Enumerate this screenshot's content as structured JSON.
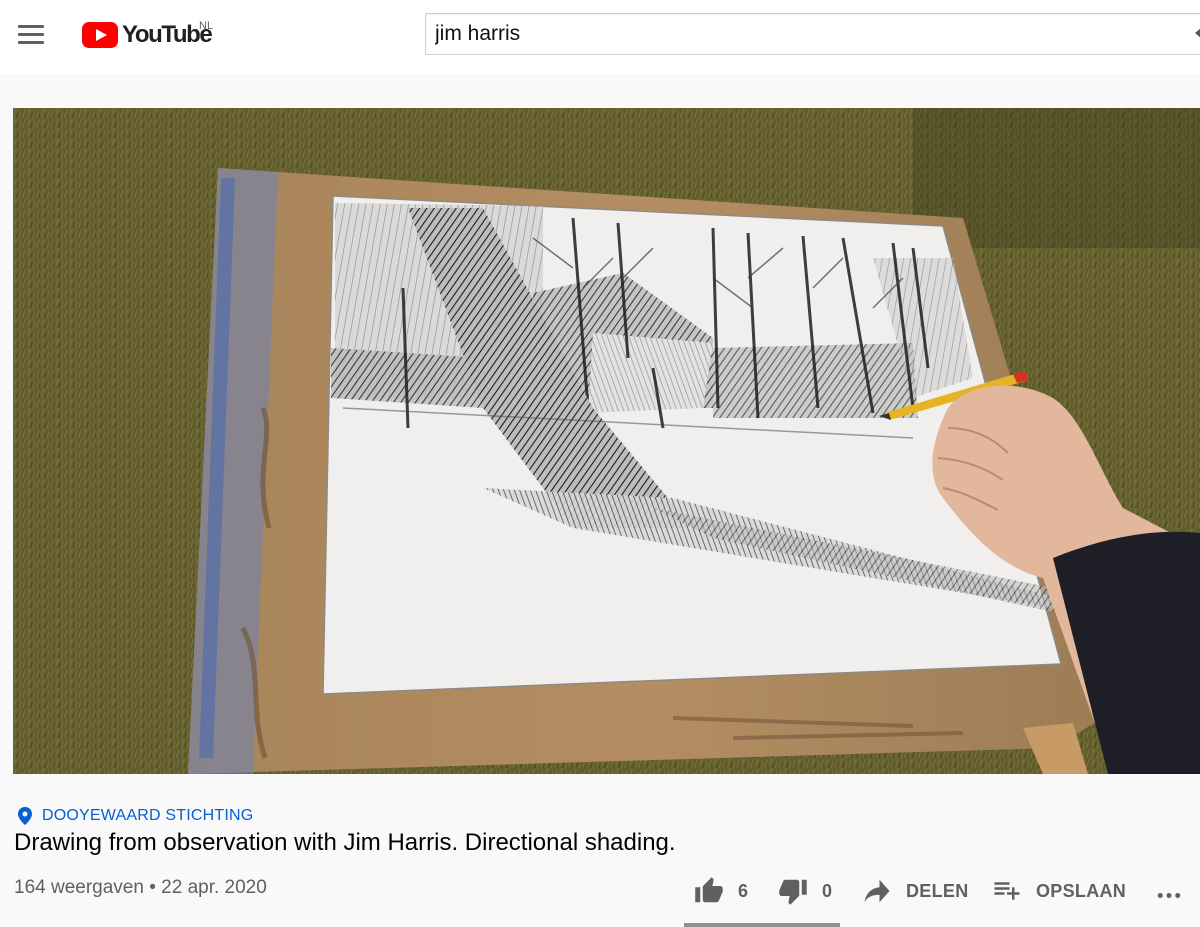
{
  "header": {
    "logo_text": "YouTube",
    "region": "NL",
    "search_value": "jim harris"
  },
  "video": {
    "location": "DOOYEWAARD STICHTING",
    "title": "Drawing from observation with Jim Harris. Directional shading.",
    "views": "164 weergaven",
    "separator": "•",
    "date": "22 apr. 2020"
  },
  "actions": {
    "like_count": "6",
    "dislike_count": "0",
    "share_label": "DELEN",
    "save_label": "OPSLAAN"
  },
  "colors": {
    "brand_red": "#ff0000",
    "link_blue": "#065fd4",
    "icon_gray": "#606060"
  },
  "icons": [
    "menu-icon",
    "youtube-logo-icon",
    "location-pin-icon",
    "thumbs-up-icon",
    "thumbs-down-icon",
    "share-icon",
    "playlist-add-icon",
    "more-icon"
  ]
}
